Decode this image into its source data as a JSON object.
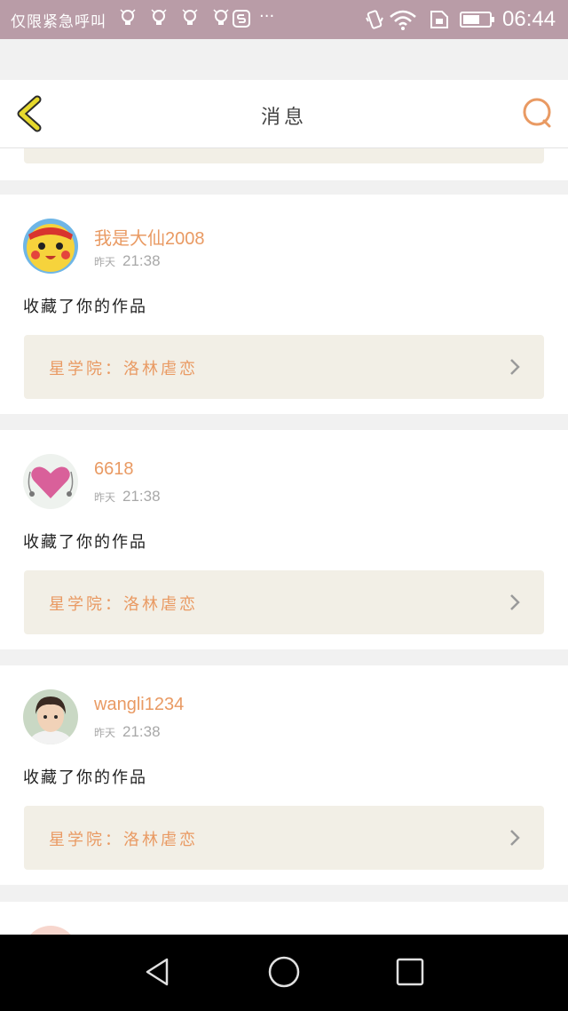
{
  "status_bar": {
    "left_text": "仅限紧急呼叫",
    "more": "···",
    "time": "06:44",
    "icons": [
      "bulb-icon",
      "bulb-icon",
      "bulb-icon",
      "bulb-icon",
      "s-app-icon",
      "vibrate-icon",
      "wifi-icon",
      "sim-icon",
      "battery-icon"
    ]
  },
  "header": {
    "title": "消息",
    "back_icon": "chevron-left-icon",
    "search_icon": "search-icon"
  },
  "notifications": [
    {
      "username": "我是大仙2008",
      "day": "昨天",
      "time": "21:38",
      "action": "收藏了你的作品",
      "work": "星学院：洛林虐恋",
      "avatar": "pikachu-avatar"
    },
    {
      "username": "6618",
      "day": "昨天",
      "time": "21:38",
      "action": "收藏了你的作品",
      "work": "星学院：洛林虐恋",
      "avatar": "heart-avatar"
    },
    {
      "username": "wangli1234",
      "day": "昨天",
      "time": "21:38",
      "action": "收藏了你的作品",
      "work": "星学院：洛林虐恋",
      "avatar": "child-photo-avatar"
    }
  ],
  "colors": {
    "accent": "#e99a63",
    "status_bar": "#b99ca7",
    "link_bg": "#f2efe6",
    "back_icon": "#e6d92d"
  },
  "nav": {
    "icons": [
      "back-triangle-icon",
      "home-circle-icon",
      "recents-square-icon"
    ]
  }
}
